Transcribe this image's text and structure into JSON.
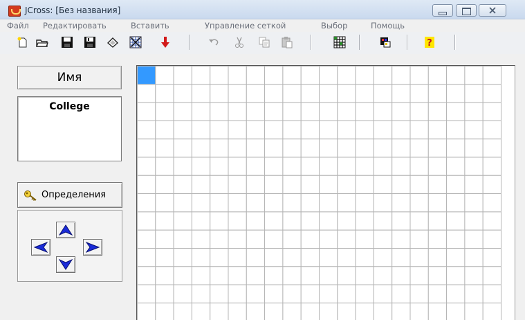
{
  "window": {
    "title": "JCross: [Без названия]"
  },
  "menu": {
    "items": [
      "Файл",
      "Редактировать",
      "Вставить",
      "Управление сеткой",
      "Выбор",
      "Помощь"
    ]
  },
  "toolbar": {
    "buttons": [
      {
        "icon": "new-file-icon"
      },
      {
        "icon": "open-folder-icon"
      },
      {
        "icon": "save-icon"
      },
      {
        "icon": "save-as-icon"
      },
      {
        "icon": "eraser-icon"
      },
      {
        "icon": "pattern-icon"
      },
      {
        "icon": "down-arrow-icon"
      },
      {
        "icon": "undo-icon"
      },
      {
        "icon": "cut-icon"
      },
      {
        "icon": "copy-icon"
      },
      {
        "icon": "paste-icon"
      },
      {
        "icon": "grid-icon"
      },
      {
        "icon": "palette-icon"
      },
      {
        "icon": "help-icon"
      }
    ]
  },
  "left_panel": {
    "name_header": "Имя",
    "words": [
      "College"
    ],
    "definitions_button": "Определения"
  },
  "grid": {
    "columns": 20,
    "rows": 14,
    "selected_cell": {
      "row": 0,
      "col": 0
    },
    "selected_color": "#3399ff"
  }
}
